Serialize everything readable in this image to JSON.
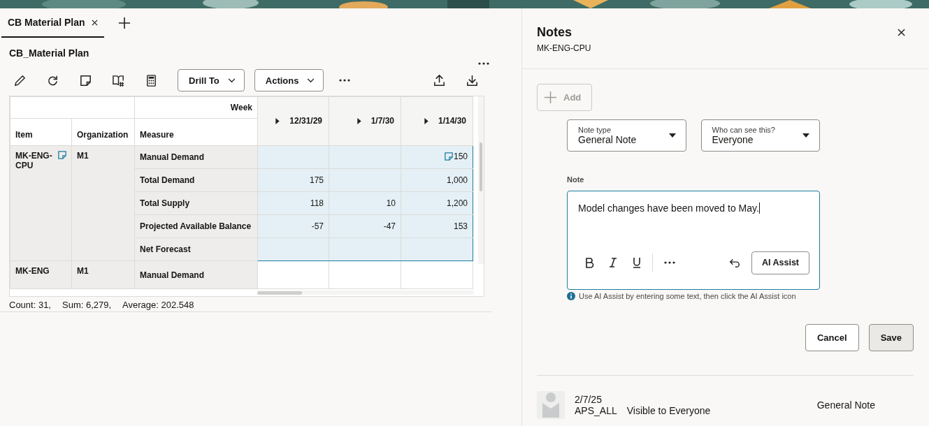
{
  "tabs": [
    {
      "label": "CB Material Plan",
      "selected": true
    }
  ],
  "page_title": "CB_Material Plan",
  "toolbar": {
    "menus": [
      "Drill To",
      "Actions"
    ]
  },
  "grid": {
    "corner_label": "Week",
    "columns": [
      "Item",
      "Organization",
      "Measure"
    ],
    "weeks": [
      "12/31/29",
      "1/7/30",
      "1/14/30"
    ],
    "groups": [
      {
        "item": "MK-ENG-CPU",
        "has_note": true,
        "organization": "M1",
        "rows": [
          {
            "measure": "Manual Demand",
            "cells": [
              {
                "selected": true
              },
              {
                "selected": true
              },
              {
                "value": "150",
                "has_note": true,
                "selected": true
              }
            ]
          },
          {
            "measure": "Total Demand",
            "cells": [
              {
                "value": "175",
                "selected": true
              },
              {
                "selected": true
              },
              {
                "value": "1,000",
                "selected": true
              }
            ]
          },
          {
            "measure": "Total Supply",
            "cells": [
              {
                "value": "118",
                "selected": true
              },
              {
                "value": "10",
                "selected": true
              },
              {
                "value": "1,200",
                "selected": true
              }
            ]
          },
          {
            "measure": "Projected Available Balance",
            "cells": [
              {
                "value": "-57",
                "selected": true
              },
              {
                "value": "-47",
                "selected": true
              },
              {
                "value": "153",
                "selected": true
              }
            ]
          },
          {
            "measure": "Net Forecast",
            "cells": [
              {
                "selected": true
              },
              {
                "selected": true
              },
              {
                "selected": true
              }
            ]
          }
        ]
      },
      {
        "item": "MK-ENG",
        "organization": "M1",
        "rows": [
          {
            "measure": "Manual Demand",
            "cells": [
              {
                "selected": false
              },
              {
                "selected": false
              },
              {
                "selected": false
              }
            ]
          }
        ]
      }
    ]
  },
  "status_bar": [
    "Count: 31,",
    "Sum: 6,279,",
    "Average: 202.548"
  ],
  "notes_panel": {
    "title": "Notes",
    "subtitle": "MK-ENG-CPU",
    "add_button": {
      "label": "Add",
      "disabled": true
    },
    "note_type": {
      "label": "Note type",
      "value": "General Note"
    },
    "visibility": {
      "label": "Who can see this?",
      "value": "Everyone"
    },
    "note": {
      "label": "Note",
      "value": "Model changes have been moved to May.",
      "hint": "Use AI Assist by entering some text, then click the AI Assist icon"
    },
    "editor": {
      "ai_button": "AI Assist"
    },
    "actions": [
      {
        "label": "Cancel",
        "hovered": false
      },
      {
        "label": "Save",
        "hovered": true
      }
    ],
    "history": [
      {
        "date": "2/7/25",
        "user": "APS_ALL",
        "visibility": "Visible to Everyone",
        "type": "General Note"
      }
    ]
  }
}
